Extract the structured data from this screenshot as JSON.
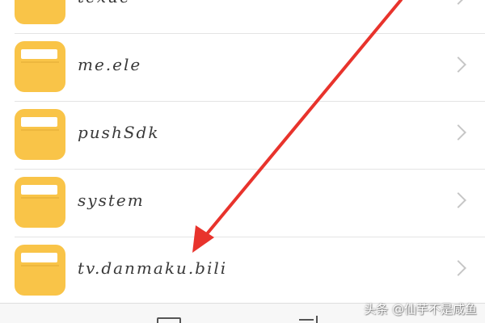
{
  "files": [
    {
      "name": "texue"
    },
    {
      "name": "me.ele"
    },
    {
      "name": "pushSdk"
    },
    {
      "name": "system"
    },
    {
      "name": "tv.danmaku.bili"
    }
  ],
  "icons": {
    "folder": "folder-icon",
    "chevron": "chevron-right-icon",
    "bottom_left": "folder-icon",
    "bottom_right": "sort-icon"
  },
  "colors": {
    "folder": "#f9c448",
    "annotation_arrow": "#e8332c"
  },
  "watermark": {
    "text": "头条 @仙芋不是咸鱼"
  }
}
